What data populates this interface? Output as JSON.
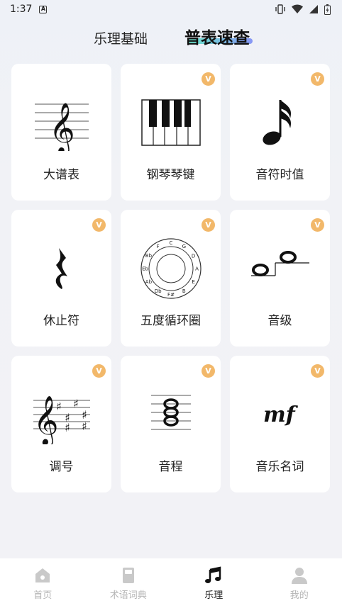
{
  "status": {
    "time": "1:37"
  },
  "header": {
    "tab_basic": "乐理基础",
    "tab_lookup": "普表速查"
  },
  "cards": [
    {
      "label": "大谱表",
      "vip": false
    },
    {
      "label": "钢琴琴键",
      "vip": true
    },
    {
      "label": "音符时值",
      "vip": true
    },
    {
      "label": "休止符",
      "vip": true
    },
    {
      "label": "五度循环圈",
      "vip": true
    },
    {
      "label": "音级",
      "vip": true
    },
    {
      "label": "调号",
      "vip": true
    },
    {
      "label": "音程",
      "vip": true
    },
    {
      "label": "音乐名词",
      "vip": true
    }
  ],
  "vip_badge": "V",
  "circle_labels": [
    "C",
    "G",
    "D",
    "A",
    "E",
    "B",
    "F#",
    "Db",
    "Ab",
    "Eb",
    "Bb",
    "F"
  ],
  "dynamic_text": "mf",
  "nav": [
    {
      "label": "首页",
      "icon": "home-icon"
    },
    {
      "label": "术语词典",
      "icon": "book-icon"
    },
    {
      "label": "乐理",
      "icon": "music-note-icon"
    },
    {
      "label": "我的",
      "icon": "user-icon"
    }
  ],
  "colors": {
    "accent_gradient_start": "#5ee3c8",
    "accent_gradient_end": "#7c8df5",
    "vip": "#f2b86a"
  }
}
